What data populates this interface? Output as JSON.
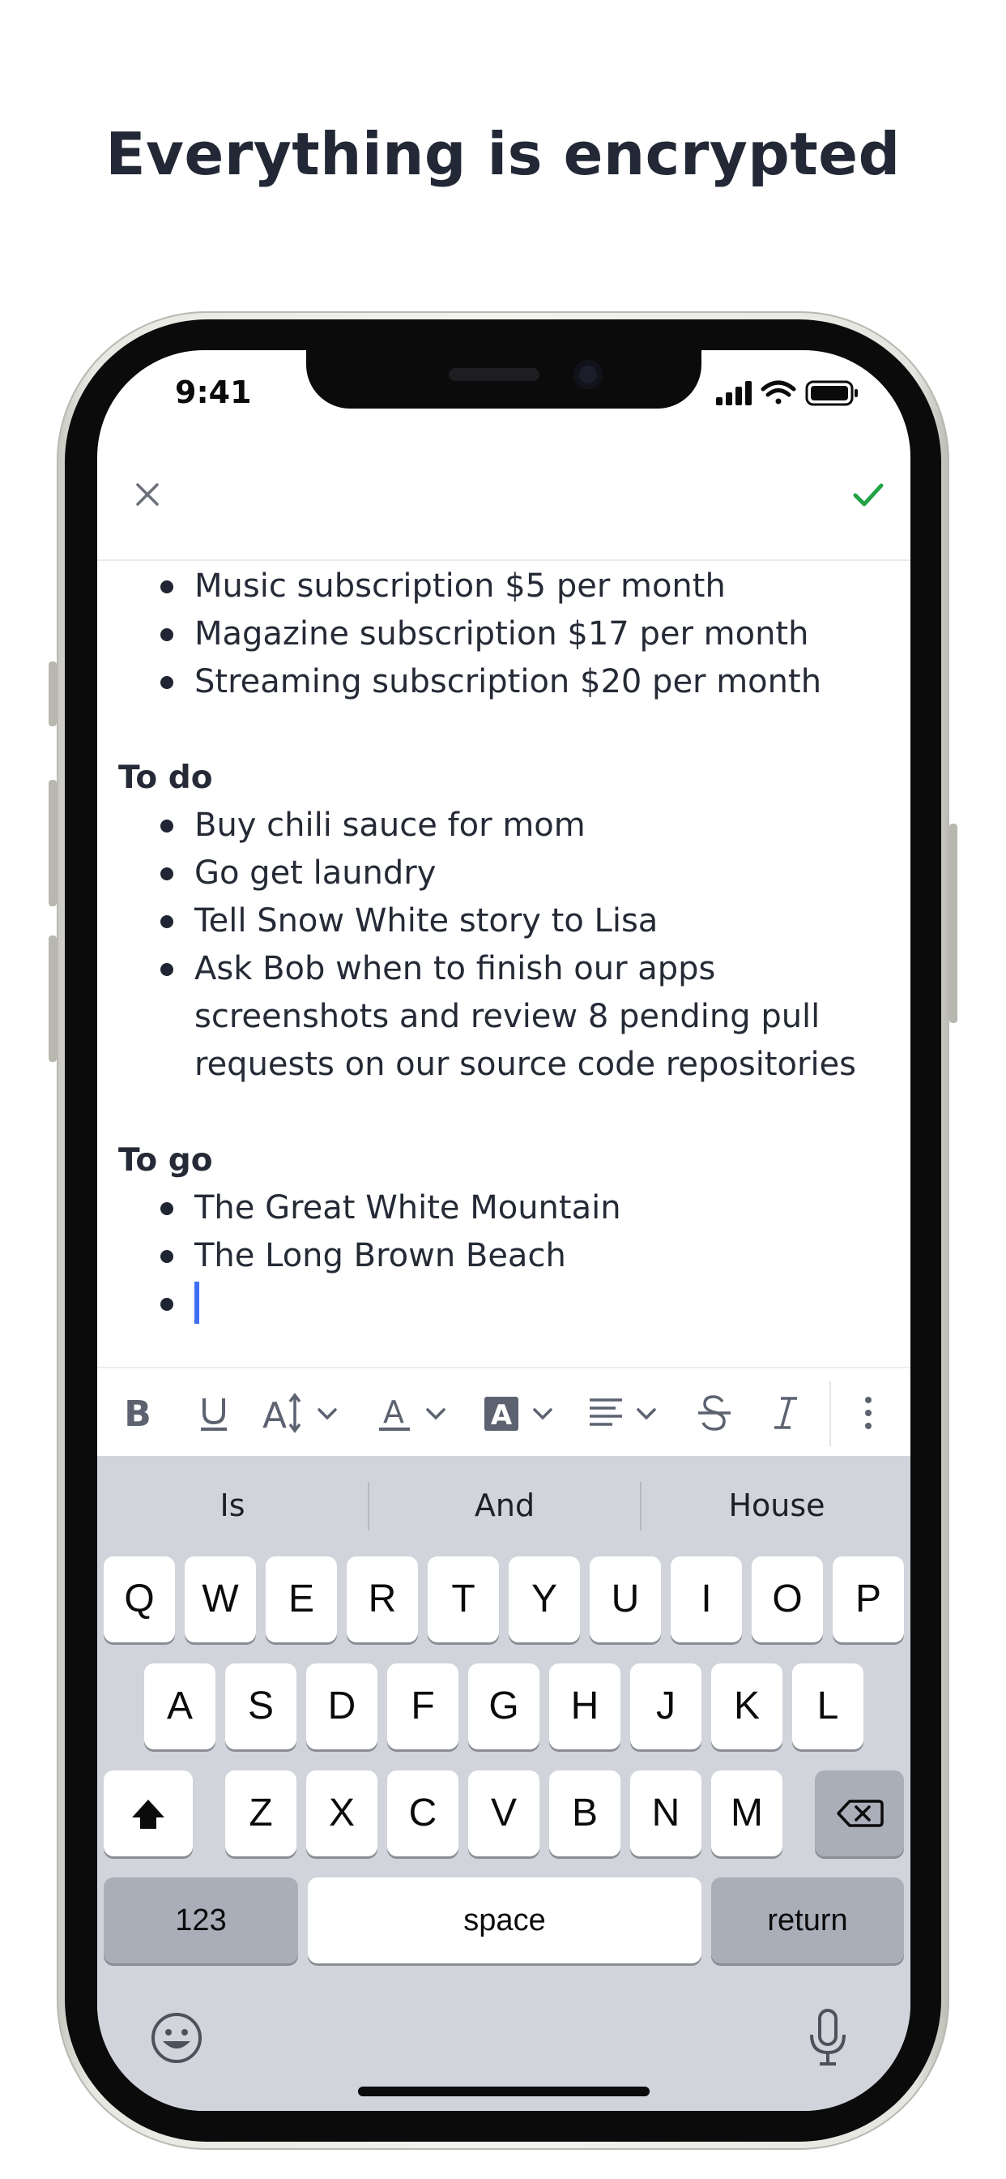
{
  "headline": "Everything is encrypted",
  "status_bar": {
    "time": "9:41"
  },
  "editor": {
    "close_icon": "close-icon",
    "confirm_icon": "checkmark-icon",
    "confirm_color": "#22a347",
    "intro_items": [
      "Music subscription $5 per month",
      "Magazine subscription $17 per month",
      "Streaming subscription $20 per month"
    ],
    "sections": [
      {
        "heading": "To do",
        "items": [
          "Buy chili sauce for mom",
          "Go get laundry",
          "Tell Snow White story to Lisa",
          "Ask Bob when to finish our apps screenshots and review 8 pending pull requests on our source code repositories"
        ]
      },
      {
        "heading": "To go",
        "items": [
          "The Great White Mountain",
          "The Long Brown Beach",
          ""
        ]
      }
    ],
    "caret_color": "#3f6ef6"
  },
  "toolbar": {
    "buttons": [
      "bold-icon",
      "underline-icon",
      "text-size-icon",
      "text-color-icon",
      "highlight-icon",
      "align-icon",
      "strikethrough-icon",
      "italic-icon",
      "more-icon"
    ]
  },
  "keyboard": {
    "suggestions": [
      "Is",
      "And",
      "House"
    ],
    "row1": [
      "Q",
      "W",
      "E",
      "R",
      "T",
      "Y",
      "U",
      "I",
      "O",
      "P"
    ],
    "row2": [
      "A",
      "S",
      "D",
      "F",
      "G",
      "H",
      "J",
      "K",
      "L"
    ],
    "row3": [
      "Z",
      "X",
      "C",
      "V",
      "B",
      "N",
      "M"
    ],
    "numbers_label": "123",
    "space_label": "space",
    "return_label": "return"
  }
}
